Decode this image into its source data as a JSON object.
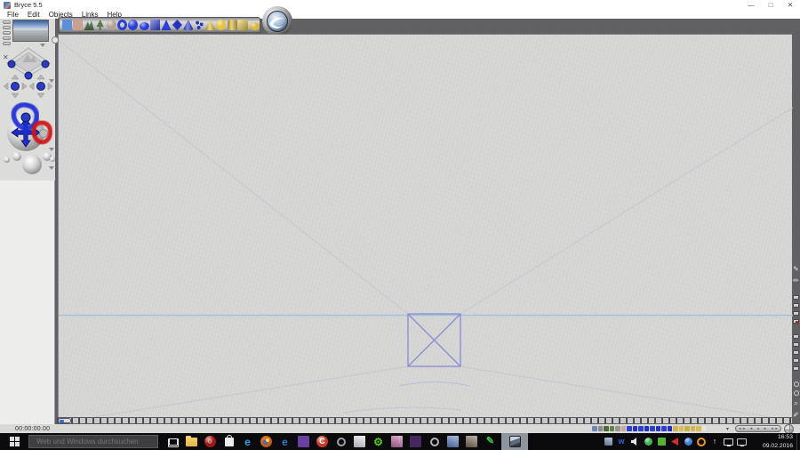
{
  "window": {
    "title": "Bryce 5.5",
    "minimize": "—",
    "maximize": "□",
    "close": "✕"
  },
  "menu_bar": {
    "items": [
      {
        "name": "menu-file",
        "label": "File"
      },
      {
        "name": "menu-edit",
        "label": "Edit"
      },
      {
        "name": "menu-objects",
        "label": "Objects"
      },
      {
        "name": "menu-links",
        "label": "Links"
      },
      {
        "name": "menu-help",
        "label": "Help"
      }
    ]
  },
  "create_palette": {
    "icons": [
      {
        "name": "water-preset-icon",
        "shape": "square",
        "color": "#5b8fd6"
      },
      {
        "name": "stone-preset-icon",
        "shape": "square",
        "color": "#c9a091"
      },
      {
        "name": "terrain-preset-icon",
        "shape": "mountain",
        "color": "#4c6b46"
      },
      {
        "name": "tree-preset-icon",
        "shape": "tree",
        "color": "#5a7a4a"
      },
      {
        "name": "rock-preset-icon",
        "shape": "circle",
        "color": "#b0a28e"
      },
      {
        "name": "torus-primitive-icon",
        "shape": "donut",
        "color": "#2b3fd4"
      },
      {
        "name": "sphere-primitive-icon",
        "shape": "circle",
        "color": "#2b3fd4"
      },
      {
        "name": "flat-sphere-primitive-icon",
        "shape": "ellipse",
        "color": "#2b3fd4"
      },
      {
        "name": "cube-primitive-icon",
        "shape": "cube",
        "color": "#2b3fd4"
      },
      {
        "name": "pyramid-primitive-icon",
        "shape": "triangle",
        "color": "#2b3fd4"
      },
      {
        "name": "diamond-primitive-icon",
        "shape": "diamond",
        "color": "#2434c0"
      },
      {
        "name": "cone-primitive-icon",
        "shape": "cone",
        "color": "#2b3fd4"
      },
      {
        "name": "group-primitive-icon",
        "shape": "dots",
        "color": "#2434c0"
      },
      {
        "name": "light-cone-icon",
        "shape": "cone",
        "color": "#e3c23e"
      },
      {
        "name": "light-sphere-icon",
        "shape": "circle",
        "color": "#e3c23e"
      },
      {
        "name": "light-cylinder-icon",
        "shape": "cylinder",
        "color": "#d9b838"
      },
      {
        "name": "light-cube-icon",
        "shape": "cube",
        "color": "#e3c23e"
      },
      {
        "name": "light-slab-icon",
        "shape": "ellipse",
        "color": "#d9b838"
      }
    ]
  },
  "left_panel": {
    "icons": [
      "preview-window",
      "view-preset-buttons",
      "camera-platform-control",
      "orbit-arrow-controls",
      "pan-trackball",
      "banking-spheres"
    ],
    "annotations": {
      "blue_ring_color": "#1f2fd4",
      "red_ring_color": "#d01414"
    }
  },
  "viewport": {
    "horizon_color": "#a7c0dd",
    "wireframe_color": "#8c90d2",
    "guide_color": "#c6c7cb"
  },
  "timeline": {
    "timecode": "00:00:00.00"
  },
  "animation_bar": {
    "dropdown_glyph": "▾",
    "mini_icons": [
      {
        "name": "mini-water-icon",
        "color": "#6d88b4"
      },
      {
        "name": "mini-ground-icon",
        "color": "#8a8a8a"
      },
      {
        "name": "mini-terrain-icon",
        "color": "#4a6b3c"
      },
      {
        "name": "mini-tree-icon",
        "color": "#5f8447"
      },
      {
        "name": "mini-rock-icon",
        "color": "#98938b"
      },
      {
        "name": "mini-stone-icon",
        "color": "#c9a59b"
      },
      {
        "name": "mini-torus-icon",
        "color": "#2b3fd4"
      },
      {
        "name": "mini-sphere-icon",
        "color": "#2434c0"
      },
      {
        "name": "mini-flat-sphere-icon",
        "color": "#2b3fd4"
      },
      {
        "name": "mini-cube-icon",
        "color": "#1e30c6"
      },
      {
        "name": "mini-pyramid-icon",
        "color": "#2b3fd4"
      },
      {
        "name": "mini-diamond-icon",
        "color": "#2434c0"
      },
      {
        "name": "mini-cone-icon",
        "color": "#2b3fd4"
      },
      {
        "name": "mini-group-icon",
        "color": "#1e30c6"
      },
      {
        "name": "mini-light-cone-icon",
        "color": "#d2b44c"
      },
      {
        "name": "mini-light-sphere-icon",
        "color": "#d8bc54"
      },
      {
        "name": "mini-light-cylinder-icon",
        "color": "#ccae44"
      },
      {
        "name": "mini-light-cube-icon",
        "color": "#d2b44c"
      },
      {
        "name": "mini-light-slab-icon",
        "color": "#d8bc54"
      },
      {
        "name": "mini-select-arrow-icon",
        "color": "#e2e2e2"
      }
    ],
    "playback": [
      {
        "name": "jump-to-start-button",
        "glyph": "◄◄"
      },
      {
        "name": "step-back-button",
        "glyph": "◄"
      },
      {
        "name": "play-button",
        "glyph": "●"
      },
      {
        "name": "step-forward-button",
        "glyph": "►"
      },
      {
        "name": "jump-to-end-button",
        "glyph": "►►"
      }
    ]
  },
  "right_toolbar": {
    "tools": [
      {
        "name": "plop-render-pencil-icon",
        "type": "tpen",
        "glyph": "✎"
      },
      {
        "name": "spray-render-icon",
        "type": "tpen",
        "glyph": "✏"
      },
      {
        "name": "tool-gap-1",
        "type": "tgap"
      },
      {
        "name": "render-mode-button-1",
        "type": "tbtn"
      },
      {
        "name": "render-mode-button-2",
        "type": "tbtn"
      },
      {
        "name": "render-mode-button-3",
        "type": "tbtn"
      },
      {
        "name": "render-active-button",
        "type": "tbtnred"
      },
      {
        "name": "tool-gap-2",
        "type": "tgap"
      },
      {
        "name": "display-mode-button-1",
        "type": "tbtn"
      },
      {
        "name": "display-mode-button-2",
        "type": "tbtn"
      },
      {
        "name": "display-mode-button-3",
        "type": "tbtn"
      },
      {
        "name": "display-mode-button-4",
        "type": "tbtn"
      },
      {
        "name": "display-mode-button-5",
        "type": "tbtn"
      },
      {
        "name": "tool-gap-3",
        "type": "tgap"
      },
      {
        "name": "lab-button-1",
        "type": "tring"
      },
      {
        "name": "lab-button-2",
        "type": "tring"
      },
      {
        "name": "zoom-tool-icon",
        "type": "tpen",
        "glyph": "⌕"
      },
      {
        "name": "hand-tool-icon",
        "type": "tpen",
        "glyph": "✐"
      }
    ]
  },
  "taskbar": {
    "search": {
      "placeholder": "Web und Windows durchsuchen"
    },
    "app_icons": [
      {
        "name": "task-view-button",
        "shape": "taskview",
        "color": "#e4e4e4",
        "glyph": ""
      },
      {
        "name": "file-explorer-button",
        "shape": "folder",
        "color": "#e9b44c",
        "glyph": ""
      },
      {
        "name": "media-recorder-button",
        "shape": "circle",
        "color": "#a01818",
        "glyph": "○"
      },
      {
        "name": "store-button",
        "shape": "bag",
        "color": "#ececec",
        "glyph": ""
      },
      {
        "name": "internet-explorer-button",
        "shape": "letter",
        "color": "#35a2e8",
        "glyph": "e"
      },
      {
        "name": "firefox-button",
        "shape": "firefox",
        "color": "#e87c2a",
        "glyph": ""
      },
      {
        "name": "edge-button",
        "shape": "letter",
        "color": "#3179d8",
        "glyph": "e"
      },
      {
        "name": "notes-app-button",
        "shape": "square",
        "color": "#6a3fa0",
        "glyph": ""
      },
      {
        "name": "ccleaner-button",
        "shape": "circle",
        "color": "#c83828",
        "glyph": "C"
      },
      {
        "name": "screenshot-tool-button",
        "shape": "ring",
        "color": "#9aa0a8",
        "glyph": ""
      },
      {
        "name": "mail-app-button",
        "shape": "img",
        "color": "#dfe3ea",
        "glyph": ""
      },
      {
        "name": "android-tool-button",
        "shape": "gear",
        "color": "#58c428",
        "glyph": "⚙"
      },
      {
        "name": "photo-viewer-button",
        "shape": "img",
        "color": "#c06aaa",
        "glyph": ""
      },
      {
        "name": "movie-app-button",
        "shape": "square",
        "color": "#43275e",
        "glyph": ""
      },
      {
        "name": "utility-button",
        "shape": "ring",
        "color": "#b4b4b8",
        "glyph": ""
      },
      {
        "name": "image-app-button",
        "shape": "img",
        "color": "#5a7ec0",
        "glyph": ""
      },
      {
        "name": "photo-editor-button",
        "shape": "img",
        "color": "#7a6a52",
        "glyph": ""
      },
      {
        "name": "paint-tool-button",
        "shape": "pen",
        "color": "#3ec43e",
        "glyph": "✎"
      }
    ],
    "active_app": {
      "name": "bryce-taskbar-button"
    },
    "tray_icons": [
      {
        "name": "tray-photo-icon",
        "shape": "img",
        "color": "#7d95ba",
        "glyph": ""
      },
      {
        "name": "tray-messenger-icon",
        "shape": "letter",
        "color": "#2f62d8",
        "glyph": "w"
      },
      {
        "name": "tray-volume-icon",
        "shape": "speaker",
        "color": "#e8e8e8",
        "glyph": ""
      },
      {
        "name": "tray-antivirus-icon",
        "shape": "circle",
        "color": "#44b44e",
        "glyph": ""
      },
      {
        "name": "tray-graphics-icon",
        "shape": "square",
        "color": "#55b432",
        "glyph": ""
      },
      {
        "name": "tray-media-icon",
        "shape": "tri",
        "color": "#d42a2a",
        "glyph": ""
      },
      {
        "name": "tray-sync-icon",
        "shape": "circle",
        "color": "#3f7fd6",
        "glyph": ""
      },
      {
        "name": "tray-updater-icon",
        "shape": "ring",
        "color": "#e8992e",
        "glyph": ""
      },
      {
        "name": "tray-device-icon",
        "shape": "letter",
        "color": "#e0e0e0",
        "glyph": "↑"
      },
      {
        "name": "tray-display-icon",
        "shape": "monitor",
        "color": "#dcdcdc",
        "glyph": ""
      },
      {
        "name": "tray-network-icon",
        "shape": "monitor",
        "color": "#c8c8c8",
        "glyph": ""
      }
    ],
    "clock": {
      "time": "16:53",
      "date": "09.02.2016"
    }
  }
}
